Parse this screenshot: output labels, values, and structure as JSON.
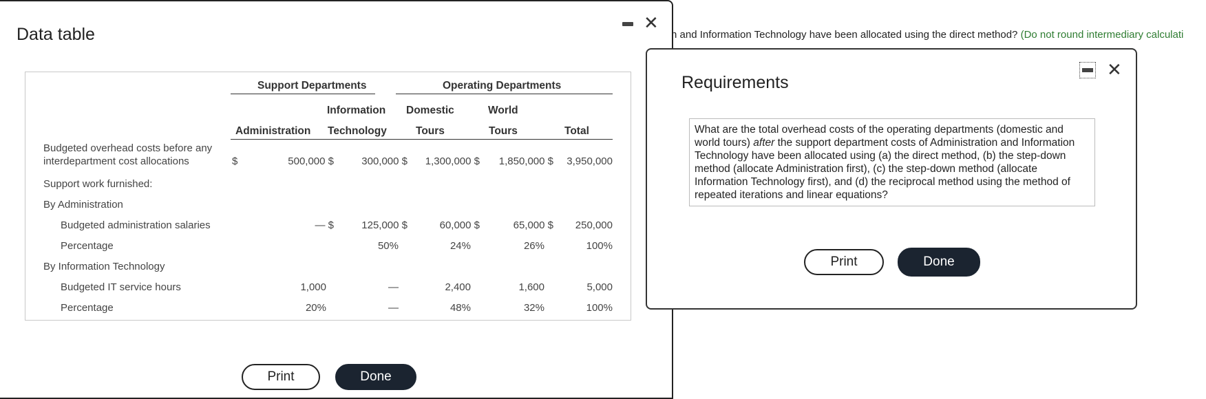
{
  "background": {
    "question_text": "n and Information Technology have been allocated using the direct method?",
    "hint_text": "(Do not round intermediary calculati"
  },
  "data_table": {
    "title": "Data table",
    "minimize_icon": "minimize-icon",
    "close_icon": "close-icon",
    "close_symbol": "✕",
    "group_headers": {
      "support": "Support Departments",
      "operating": "Operating Departments"
    },
    "columns": {
      "admin": "Administration",
      "it_top": "Information",
      "it_bottom": "Technology",
      "domestic_top": "Domestic",
      "domestic_bottom": "Tours",
      "world_top": "World",
      "world_bottom": "Tours",
      "total": "Total"
    },
    "rows": {
      "budgeted_label_1": "Budgeted overhead costs before any",
      "budgeted_label_2": "interdepartment cost allocations",
      "budgeted_dollar": "$",
      "budgeted_admin": "500,000 $",
      "budgeted_it": "300,000 $",
      "budgeted_domestic": "1,300,000 $",
      "budgeted_world": "1,850,000 $",
      "budgeted_total": "3,950,000",
      "support_work": "Support work furnished:",
      "by_admin": "By Administration",
      "admin_salaries_label": "Budgeted administration salaries",
      "admin_salaries_admin": "— $",
      "admin_salaries_it": "125,000 $",
      "admin_salaries_domestic": "60,000 $",
      "admin_salaries_world": "65,000 $",
      "admin_salaries_total": "250,000",
      "admin_pct_label": "Percentage",
      "admin_pct_it": "50%",
      "admin_pct_domestic": "24%",
      "admin_pct_world": "26%",
      "admin_pct_total": "100%",
      "by_it": "By Information Technology",
      "it_hours_label": "Budgeted IT service hours",
      "it_hours_admin": "1,000",
      "it_hours_it": "—",
      "it_hours_domestic": "2,400",
      "it_hours_world": "1,600",
      "it_hours_total": "5,000",
      "it_pct_label": "Percentage",
      "it_pct_admin": "20%",
      "it_pct_it": "—",
      "it_pct_domestic": "48%",
      "it_pct_world": "32%",
      "it_pct_total": "100%"
    },
    "print_label": "Print",
    "done_label": "Done"
  },
  "requirements": {
    "title": "Requirements",
    "text_part1": "What are the total overhead costs of the operating departments (domestic and world tours) ",
    "text_italic": "after",
    "text_part2": " the support department costs of Administration and Information Technology have been allocated using (a) the direct method, (b) the step-down method (allocate Administration first), (c) the step-down method (allocate Information Technology first), and (d) the reciprocal method using the method of repeated iterations and linear equations?",
    "close_symbol": "✕",
    "print_label": "Print",
    "done_label": "Done"
  }
}
